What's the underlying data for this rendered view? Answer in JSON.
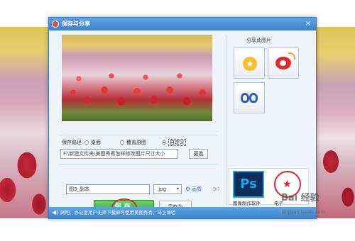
{
  "dialog": {
    "title": "保存与分享",
    "close_glyph": "×"
  },
  "save_path": {
    "label": "保存路径",
    "options": [
      "桌面",
      "覆盖原图",
      "自定义"
    ],
    "selected": "自定义",
    "path_value": "F:\\新建文件夹\\美图秀秀怎样修改图片尺寸大小",
    "change_label": "更改"
  },
  "file": {
    "name_value": "图3_副本",
    "format": ".jpg",
    "format_arrow": "▾",
    "quality_icon": "⚙",
    "quality_label": "画质",
    "quality_value": "90"
  },
  "buttons": {
    "save": "保存",
    "save_as": "另存为"
  },
  "share": {
    "title": "分享此图片",
    "services": [
      "qzone-icon",
      "weibo-icon",
      "renren-icon"
    ]
  },
  "thumbs": {
    "app1_letters": "Ps",
    "app1_caption": "图像制作软件",
    "app2_caption": "电子"
  },
  "statusbar": {
    "text": "网吧、办公室用户无须下载即可使用美图秀秀，马上体验"
  },
  "watermark": {
    "text": "Bai 经验",
    "sub": "jingyan.baidu.com"
  },
  "colors": {
    "titlebar": "#3b82cf",
    "save_green": "#34a42e",
    "highlight_ring": "#d3322a"
  }
}
